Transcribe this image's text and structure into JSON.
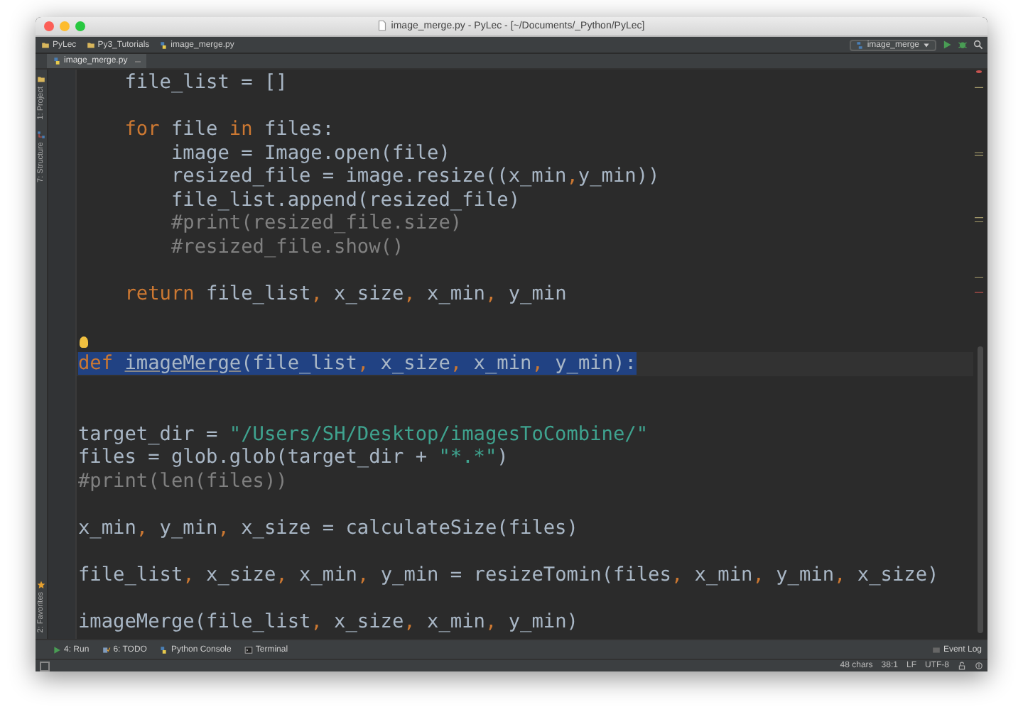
{
  "window": {
    "title": "image_merge.py - PyLec - [~/Documents/_Python/PyLec]"
  },
  "breadcrumbs": [
    {
      "label": "PyLec",
      "kind": "folder"
    },
    {
      "label": "Py3_Tutorials",
      "kind": "folder"
    },
    {
      "label": "image_merge.py",
      "kind": "python"
    }
  ],
  "run_config": {
    "label": "image_merge"
  },
  "tabs": [
    {
      "label": "image_merge.py",
      "selected": true
    }
  ],
  "left_tools_top": [
    {
      "label": "1: Project",
      "kind": "project"
    },
    {
      "label": "7: Structure",
      "kind": "structure"
    }
  ],
  "left_tools_bottom": [
    {
      "label": "2: Favorites",
      "kind": "favorites"
    }
  ],
  "editor": {
    "lines": [
      {
        "kind": "code",
        "selected": false,
        "tokens": [
          {
            "kind": "plain",
            "text": "    file_list = []"
          }
        ]
      },
      {
        "kind": "blank"
      },
      {
        "kind": "code",
        "selected": false,
        "tokens": [
          {
            "kind": "kw",
            "text": "    for"
          },
          {
            "kind": "plain",
            "text": " file "
          },
          {
            "kind": "kw",
            "text": "in"
          },
          {
            "kind": "plain",
            "text": " files:"
          }
        ]
      },
      {
        "kind": "code",
        "selected": false,
        "tokens": [
          {
            "kind": "plain",
            "text": "        image = Image.open(file)"
          }
        ]
      },
      {
        "kind": "code",
        "selected": false,
        "tokens": [
          {
            "kind": "plain",
            "text": "        resized_file = image.resize((x_min"
          },
          {
            "kind": "punct",
            "text": ","
          },
          {
            "kind": "plain",
            "text": "y_min))"
          }
        ]
      },
      {
        "kind": "code",
        "selected": false,
        "tokens": [
          {
            "kind": "plain",
            "text": "        file_list.append(resized_file)"
          }
        ]
      },
      {
        "kind": "code",
        "selected": false,
        "tokens": [
          {
            "kind": "comment",
            "text": "        #print(resized_file.size)"
          }
        ]
      },
      {
        "kind": "code",
        "selected": false,
        "tokens": [
          {
            "kind": "comment",
            "text": "        #resized_file.show()"
          }
        ]
      },
      {
        "kind": "blank"
      },
      {
        "kind": "code",
        "selected": false,
        "tokens": [
          {
            "kind": "kw",
            "text": "    return"
          },
          {
            "kind": "plain",
            "text": " file_list"
          },
          {
            "kind": "punct",
            "text": ","
          },
          {
            "kind": "plain",
            "text": " x_size"
          },
          {
            "kind": "punct",
            "text": ","
          },
          {
            "kind": "plain",
            "text": " x_min"
          },
          {
            "kind": "punct",
            "text": ","
          },
          {
            "kind": "plain",
            "text": " y_min"
          }
        ]
      },
      {
        "kind": "blank"
      },
      {
        "kind": "blank",
        "bulb": true
      },
      {
        "kind": "code",
        "selected": true,
        "tokens": [
          {
            "kind": "kw",
            "text": "def "
          },
          {
            "kind": "fn",
            "text": "imageMerge"
          },
          {
            "kind": "plain",
            "text": "(file_list"
          },
          {
            "kind": "punct",
            "text": ","
          },
          {
            "kind": "plain",
            "text": " x_size"
          },
          {
            "kind": "punct",
            "text": ","
          },
          {
            "kind": "plain",
            "text": " x_min"
          },
          {
            "kind": "punct",
            "text": ","
          },
          {
            "kind": "plain",
            "text": " y_min):"
          }
        ]
      },
      {
        "kind": "blank"
      },
      {
        "kind": "blank"
      },
      {
        "kind": "code",
        "selected": false,
        "tokens": [
          {
            "kind": "plain",
            "text": "target_dir = "
          },
          {
            "kind": "str",
            "text": "\"/Users/SH/Desktop/imagesToCombine/\""
          }
        ]
      },
      {
        "kind": "code",
        "selected": false,
        "tokens": [
          {
            "kind": "plain",
            "text": "files = glob.glob(target_dir + "
          },
          {
            "kind": "str",
            "text": "\"*.*\""
          },
          {
            "kind": "plain",
            "text": ")"
          }
        ]
      },
      {
        "kind": "code",
        "selected": false,
        "tokens": [
          {
            "kind": "comment",
            "text": "#print(len(files))"
          }
        ]
      },
      {
        "kind": "blank"
      },
      {
        "kind": "code",
        "selected": false,
        "tokens": [
          {
            "kind": "plain",
            "text": "x_min"
          },
          {
            "kind": "punct",
            "text": ","
          },
          {
            "kind": "plain",
            "text": " y_min"
          },
          {
            "kind": "punct",
            "text": ","
          },
          {
            "kind": "plain",
            "text": " x_size = calculateSize(files)"
          }
        ]
      },
      {
        "kind": "blank"
      },
      {
        "kind": "code",
        "selected": false,
        "tokens": [
          {
            "kind": "plain",
            "text": "file_list"
          },
          {
            "kind": "punct",
            "text": ","
          },
          {
            "kind": "plain",
            "text": " x_size"
          },
          {
            "kind": "punct",
            "text": ","
          },
          {
            "kind": "plain",
            "text": " x_min"
          },
          {
            "kind": "punct",
            "text": ","
          },
          {
            "kind": "plain",
            "text": " y_min = resizeTomin(files"
          },
          {
            "kind": "punct",
            "text": ","
          },
          {
            "kind": "plain",
            "text": " x_min"
          },
          {
            "kind": "punct",
            "text": ","
          },
          {
            "kind": "plain",
            "text": " y_min"
          },
          {
            "kind": "punct",
            "text": ","
          },
          {
            "kind": "plain",
            "text": " x_size)"
          }
        ]
      },
      {
        "kind": "blank"
      },
      {
        "kind": "code",
        "selected": false,
        "tokens": [
          {
            "kind": "plain",
            "text": "imageMerge(file_list"
          },
          {
            "kind": "punct",
            "text": ","
          },
          {
            "kind": "plain",
            "text": " x_size"
          },
          {
            "kind": "punct",
            "text": ","
          },
          {
            "kind": "plain",
            "text": " x_min"
          },
          {
            "kind": "punct",
            "text": ","
          },
          {
            "kind": "plain",
            "text": " y_min)"
          }
        ]
      }
    ]
  },
  "bottom_tools": [
    {
      "label": "4: Run",
      "kind": "run"
    },
    {
      "label": "6: TODO",
      "kind": "todo"
    },
    {
      "label": "Python Console",
      "kind": "console"
    },
    {
      "label": "Terminal",
      "kind": "terminal"
    }
  ],
  "event_log": {
    "label": "Event Log"
  },
  "status_bar": {
    "items": [
      "48 chars",
      "38:1",
      "LF",
      "UTF-8"
    ]
  }
}
